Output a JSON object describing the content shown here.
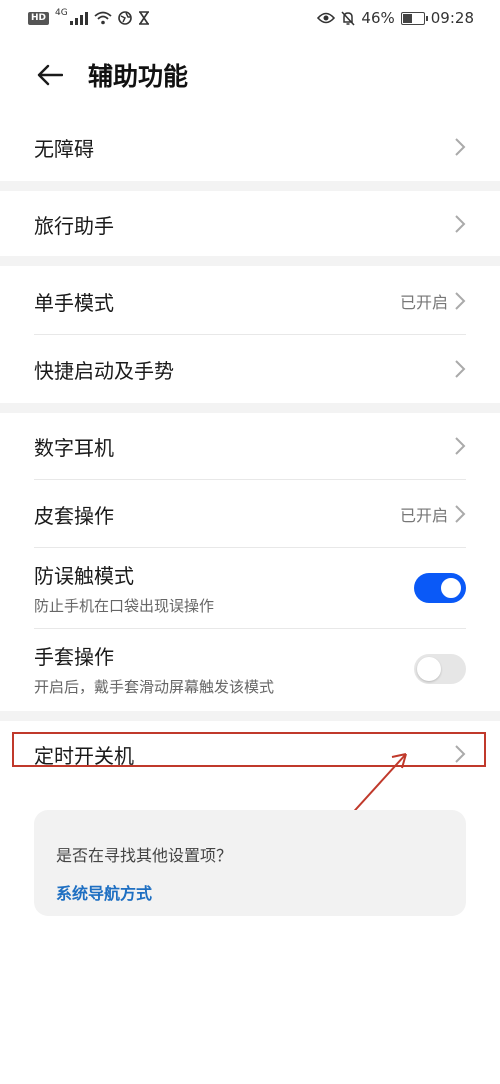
{
  "status_bar": {
    "hd": "HD",
    "network": "4G",
    "battery_percent": "46%",
    "battery_level": 0.46,
    "time": "09:28"
  },
  "header": {
    "title": "辅助功能"
  },
  "items": [
    {
      "label": "无障碍",
      "value": ""
    },
    {
      "label": "旅行助手",
      "value": ""
    },
    {
      "label": "单手模式",
      "value": "已开启"
    },
    {
      "label": "快捷启动及手势",
      "value": ""
    },
    {
      "label": "数字耳机",
      "value": ""
    },
    {
      "label": "皮套操作",
      "value": "已开启"
    },
    {
      "label": "防误触模式",
      "sub": "防止手机在口袋出现误操作",
      "toggle": true
    },
    {
      "label": "手套操作",
      "sub": "开启后，戴手套滑动屏幕触发该模式",
      "toggle": false
    },
    {
      "label": "定时开关机",
      "value": ""
    }
  ],
  "suggest": {
    "question": "是否在寻找其他设置项？",
    "link": "系统导航方式"
  },
  "colors": {
    "accent": "#0a59f7",
    "link": "#1e6fc2",
    "annotation": "#c0392b"
  }
}
